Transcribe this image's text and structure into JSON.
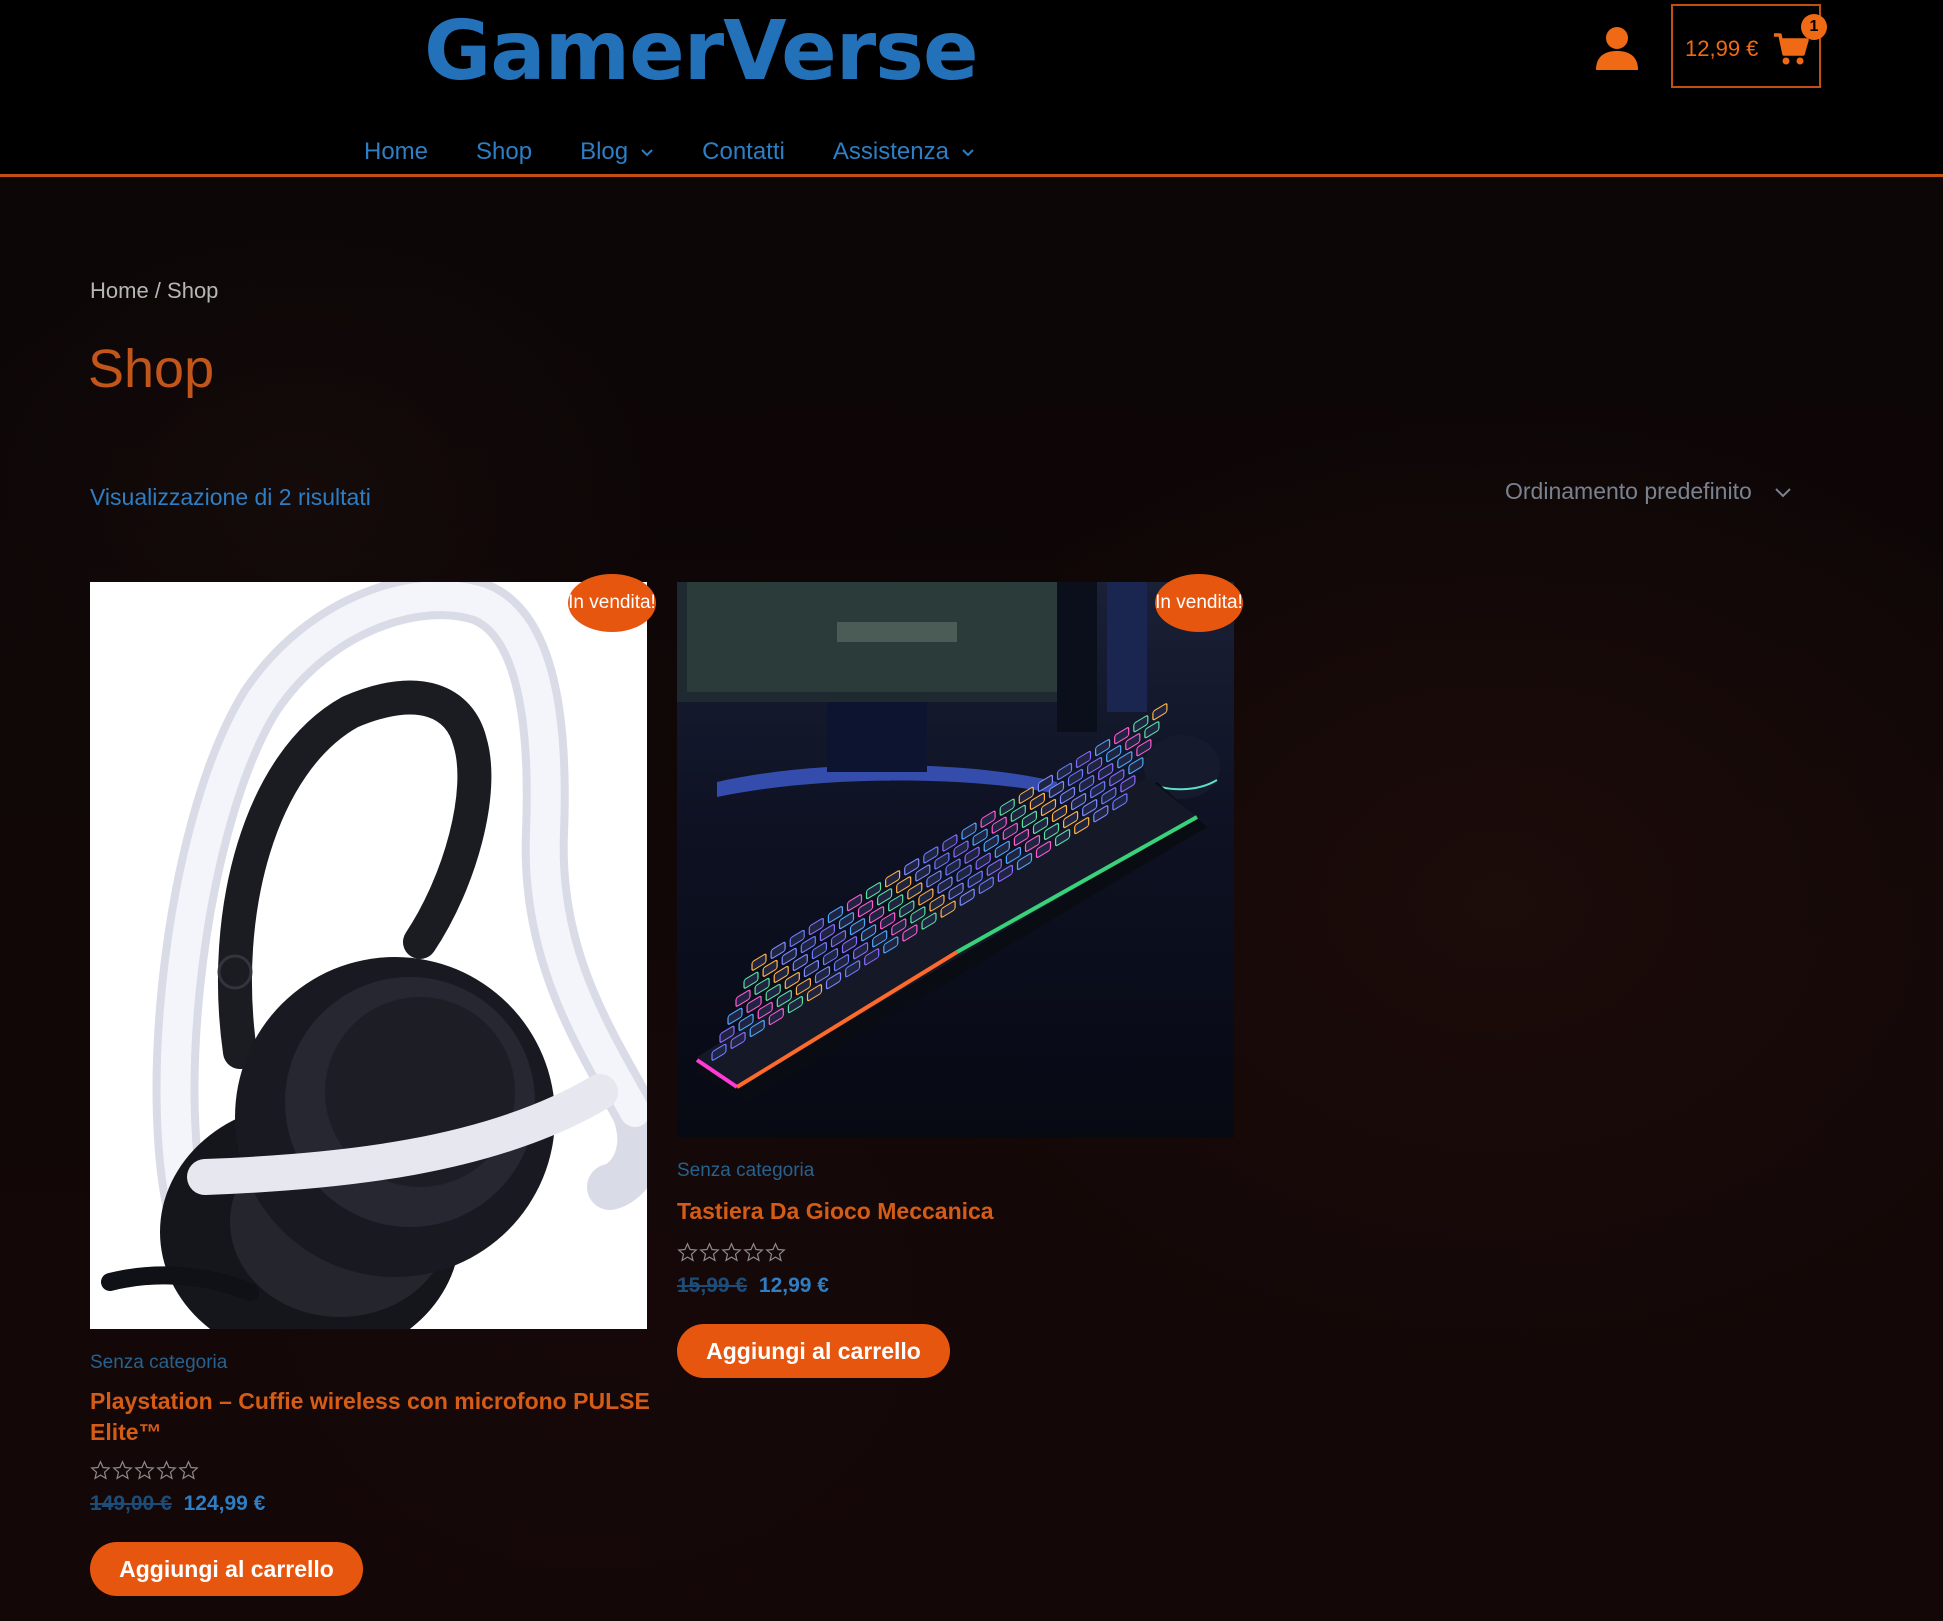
{
  "header": {
    "logo": "GamerVerse",
    "nav": [
      {
        "label": "Home",
        "has_dropdown": false
      },
      {
        "label": "Shop",
        "has_dropdown": false
      },
      {
        "label": "Blog",
        "has_dropdown": true
      },
      {
        "label": "Contatti",
        "has_dropdown": false
      },
      {
        "label": "Assistenza",
        "has_dropdown": true
      }
    ],
    "account_icon": "user-icon",
    "cart": {
      "total": "12,99 €",
      "count": "1",
      "icon": "cart-icon"
    }
  },
  "breadcrumb": {
    "home": "Home",
    "separator": " / ",
    "current": "Shop"
  },
  "page_title": "Shop",
  "result_count": "Visualizzazione di 2 risultati",
  "ordering": {
    "selected": "Ordinamento predefinito"
  },
  "colors": {
    "accent": "#e7560f",
    "link": "#2d7ec4",
    "logo": "#2371b9"
  },
  "products": [
    {
      "image": "headset-image",
      "badge": "In vendita!",
      "category": "Senza categoria",
      "title": "Playstation – Cuffie wireless con microfono PULSE Elite™",
      "rating": 0,
      "old_price": "149,00 €",
      "price": "124,99 €",
      "button": "Aggiungi al carrello"
    },
    {
      "image": "keyboard-image",
      "badge": "In vendita!",
      "category": "Senza categoria",
      "title": "Tastiera Da Gioco Meccanica",
      "rating": 0,
      "old_price": "15,99 €",
      "price": "12,99 €",
      "button": "Aggiungi al carrello"
    }
  ]
}
